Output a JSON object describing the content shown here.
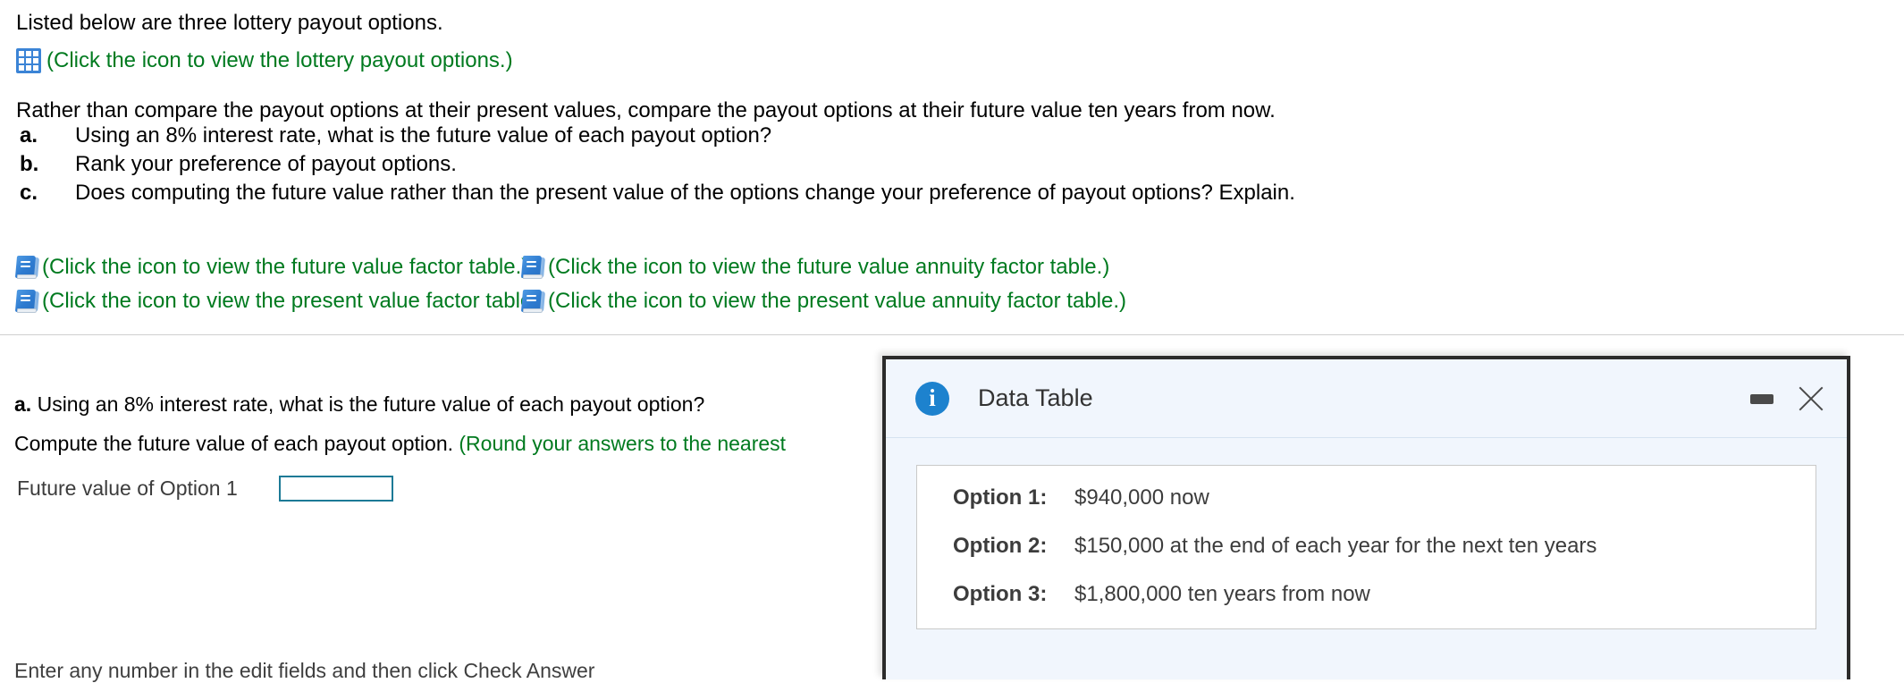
{
  "intro": {
    "line": "Listed below are three lottery payout options."
  },
  "lottery_link": {
    "icon": "grid-table-icon",
    "label": "(Click the icon to view the lottery payout options.)"
  },
  "prompt": {
    "rather_line": "Rather than compare the payout options at their present values, compare the payout options at their future value ten years from now.",
    "items": [
      {
        "marker": "a.",
        "text": "Using an 8% interest rate, what is the future value of each payout option?"
      },
      {
        "marker": "b.",
        "text": "Rank your preference of payout options."
      },
      {
        "marker": "c.",
        "text": "Does computing the future value rather than the present value of the options change your preference of payout options? Explain."
      }
    ]
  },
  "factor_table_links": [
    {
      "icon": "book-icon",
      "label": "(Click the icon to view the future value factor table.)"
    },
    {
      "icon": "book-icon",
      "label": "(Click the icon to view the present value factor table.)"
    },
    {
      "icon": "book-icon",
      "label": "(Click the icon to view the future value annuity factor table.)"
    },
    {
      "icon": "book-icon",
      "label": "(Click the icon to view the present value annuity factor table.)"
    }
  ],
  "answer_area": {
    "part_marker": "a.",
    "part_question": "Using an 8% interest rate, what is the future value of each payout option?",
    "compute_text": "Compute the future value of each payout option.",
    "compute_hint": "(Round your answers to the nearest",
    "field_label": "Future value of Option 1",
    "field_value": "",
    "field_placeholder": "",
    "bottom_note": "Enter any number in the edit fields and then click Check Answer"
  },
  "dialog": {
    "icon": "info-icon",
    "icon_glyph": "i",
    "title": "Data Table",
    "minimize_label": "",
    "close_glyph": "",
    "options": [
      {
        "key": "Option 1:",
        "value": "$940,000 now"
      },
      {
        "key": "Option 2:",
        "value": "$150,000 at the end of each year for the next ten years"
      },
      {
        "key": "Option 3:",
        "value": "$1,800,000 ten years from now"
      }
    ]
  },
  "colors": {
    "link_green": "#007a1f",
    "icon_blue": "#3b84d6",
    "input_border": "#1c7a96",
    "dialog_header_bg": "#f1f6fd",
    "dialog_border": "#2b2b2b",
    "info_blue": "#1d82ce"
  }
}
